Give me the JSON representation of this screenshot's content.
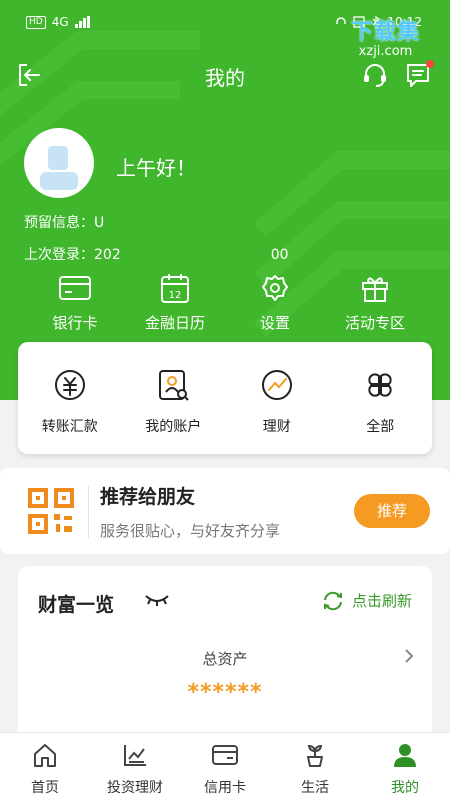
{
  "status_bar": {
    "network": "HD",
    "signal": "4G",
    "time": "10:12"
  },
  "watermark": {
    "title": "下载集",
    "site": "xzji.com"
  },
  "header": {
    "title": "我的"
  },
  "profile": {
    "greeting": "上午好！",
    "reserved_info_label": "预留信息：",
    "reserved_info_value": "U",
    "last_login_label": "上次登录：",
    "last_login_value_start": "202",
    "last_login_value_end": "00"
  },
  "shortcuts": [
    {
      "label": "银行卡",
      "icon": "bank-card-icon"
    },
    {
      "label": "金融日历",
      "icon": "calendar-icon"
    },
    {
      "label": "设置",
      "icon": "gear-icon"
    },
    {
      "label": "活动专区",
      "icon": "gift-icon"
    }
  ],
  "calendar_day": "12",
  "quick_actions": [
    {
      "label": "转账汇款",
      "icon": "transfer-icon"
    },
    {
      "label": "我的账户",
      "icon": "account-icon"
    },
    {
      "label": "理财",
      "icon": "finance-icon"
    },
    {
      "label": "全部",
      "icon": "all-icon"
    }
  ],
  "recommend": {
    "title": "推荐给朋友",
    "subtitle": "服务很贴心，与好友齐分享",
    "button": "推荐"
  },
  "wealth": {
    "title": "财富一览",
    "refresh": "点击刷新",
    "total_label": "总资产",
    "total_value": "******"
  },
  "tabs": [
    {
      "label": "首页",
      "icon": "home-icon",
      "active": false
    },
    {
      "label": "投资理财",
      "icon": "investment-icon",
      "active": false
    },
    {
      "label": "信用卡",
      "icon": "credit-card-icon",
      "active": false
    },
    {
      "label": "生活",
      "icon": "life-icon",
      "active": false
    },
    {
      "label": "我的",
      "icon": "profile-icon",
      "active": true
    }
  ],
  "colors": {
    "brand_green": "#3fb62c",
    "accent_orange": "#f59a23",
    "active_tab": "#2e8f22"
  }
}
